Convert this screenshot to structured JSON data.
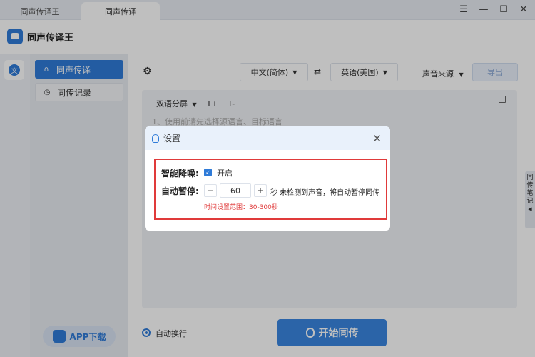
{
  "window": {
    "tabs": [
      "同声传译王",
      "同声传译"
    ],
    "controls": [
      "menu",
      "minimize",
      "maximize",
      "close"
    ]
  },
  "app": {
    "title": "同声传译王"
  },
  "sidebar": {
    "items": [
      {
        "label": "同声传译",
        "active": true
      },
      {
        "label": "同传记录",
        "active": false
      }
    ],
    "app_download": "APP下载"
  },
  "toolbar": {
    "source_lang": "中文(简体)",
    "target_lang": "英语(美国)",
    "sound_source": "声音来源",
    "export_label": "导出"
  },
  "editor": {
    "view_mode": "双语分屏",
    "font_up": "T+",
    "font_down": "T-",
    "hint": "1、使用前请先选择源语言、目标语言"
  },
  "notes_tab": "同传笔记",
  "footer": {
    "auto_wrap_label": "自动换行",
    "start_button": "开始同传"
  },
  "dialog": {
    "title": "设置",
    "noise_label": "智能降噪:",
    "noise_option": "开启",
    "noise_enabled": true,
    "pause_label": "自动暂停:",
    "pause_value": "60",
    "pause_desc": "秒 未检测到声音，将自动暂停同传",
    "range_hint": "时间设置范围：30-300秒"
  },
  "colors": {
    "accent": "#2f7bd8",
    "highlight_border": "#e03a3a"
  }
}
